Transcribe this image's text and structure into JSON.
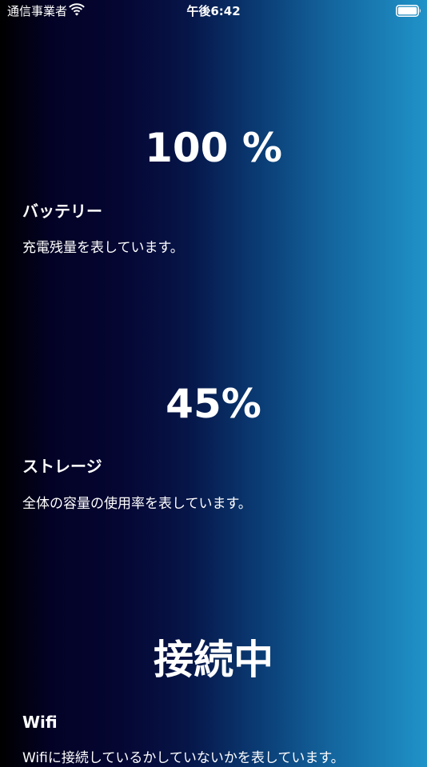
{
  "status_bar": {
    "carrier": "通信事業者",
    "time": "午後6:42",
    "wifi_icon": "wifi-icon",
    "battery_icon": "battery-full-icon"
  },
  "sections": {
    "battery": {
      "value": "100 %",
      "title": "バッテリー",
      "description": "充電残量を表しています。"
    },
    "storage": {
      "value": "45%",
      "title": "ストレージ",
      "description": "全体の容量の使用率を表しています。"
    },
    "wifi": {
      "value": "接続中",
      "title": "Wifi",
      "description": "Wifiに接続しているかしていないかを表しています。"
    }
  },
  "colors": {
    "gradient_left": "#000000",
    "gradient_mid": "#061548",
    "gradient_right": "#1f93c8",
    "text": "#ffffff"
  }
}
